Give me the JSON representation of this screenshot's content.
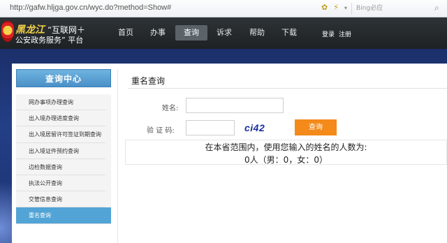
{
  "browser": {
    "url": "http://gafw.hljga.gov.cn/wyc.do?method=Show#",
    "search_placeholder": "Bing必应",
    "search_icon": "magnifier-icon",
    "extension_icons": [
      "bee-icon",
      "lightning-icon",
      "dropdown-icon"
    ]
  },
  "header": {
    "logo_emblem": "police-emblem-icon",
    "logo_province": "黑龙江",
    "logo_tag": "“互联网＋",
    "logo_line2": "公安政务服务” 平台",
    "nav": [
      {
        "label": "首页",
        "active": false
      },
      {
        "label": "办事",
        "active": false
      },
      {
        "label": "查询",
        "active": true
      },
      {
        "label": "诉求",
        "active": false
      },
      {
        "label": "帮助",
        "active": false
      },
      {
        "label": "下载",
        "active": false
      }
    ],
    "login_label": "登录",
    "register_label": "注册"
  },
  "sidebar": {
    "title": "查询中心",
    "items": [
      {
        "label": "网办事项办理查询",
        "active": false
      },
      {
        "label": "出入境办理进度查询",
        "active": false
      },
      {
        "label": "出入境居留许可签证到期查询",
        "active": false
      },
      {
        "label": "出入境证件预约查询",
        "active": false
      },
      {
        "label": "边检数据查询",
        "active": false
      },
      {
        "label": "执法公开查询",
        "active": false
      },
      {
        "label": "交管信息查询",
        "active": false
      },
      {
        "label": "重名查询",
        "active": true
      }
    ]
  },
  "form": {
    "title": "重名查询",
    "name_label": "姓名:",
    "name_value": "",
    "captcha_label": "验 证 码:",
    "captcha_value": "",
    "captcha_image_text": "ci42",
    "submit_label": "查询"
  },
  "result": {
    "line1": "在本省范围内，使用您输入的姓名的人数为:",
    "line2": "0人（男：0，女：0）"
  },
  "colors": {
    "header_bg": "#24282b",
    "band_blue": "#233f86",
    "sidebar_accent": "#52a4d6",
    "button_orange": "#f38a1a",
    "captcha_blue": "#1a2fa0"
  }
}
